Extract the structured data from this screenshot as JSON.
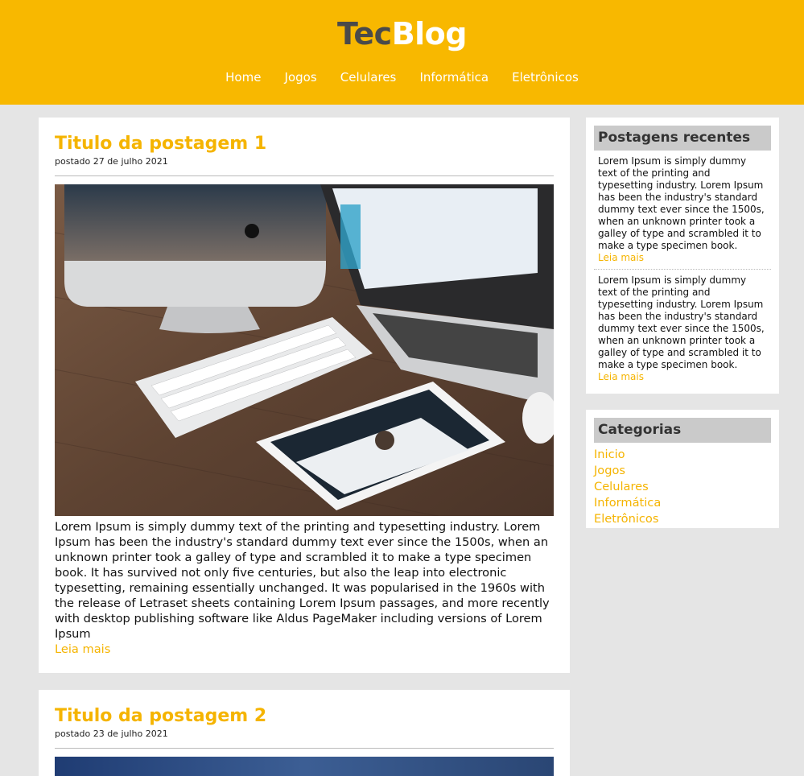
{
  "colors": {
    "brand_yellow": "#f8b800",
    "link_yellow": "#f5b400",
    "logo_dark": "#4a4a4a"
  },
  "header": {
    "logo_part1": "Tec",
    "logo_part2": "Blog",
    "nav": [
      "Home",
      "Jogos",
      "Celulares",
      "Informática",
      "Eletrônicos"
    ]
  },
  "posts": [
    {
      "title": "Titulo da postagem 1",
      "date": "postado 27 de julho 2021",
      "body": "Lorem Ipsum is simply dummy text of the printing and typesetting industry. Lorem Ipsum has been the industry's standard dummy text ever since the 1500s, when an unknown printer took a galley of type and scrambled it to make a type specimen book. It has survived not only five centuries, but also the leap into electronic typesetting, remaining essentially unchanged. It was popularised in the 1960s with the release of Letraset sheets containing Lorem Ipsum passages, and more recently with desktop publishing software like Aldus PageMaker including versions of Lorem Ipsum",
      "more": "Leia mais"
    },
    {
      "title": "Titulo da postagem 2",
      "date": "postado 23 de julho 2021"
    }
  ],
  "sidebar": {
    "recent": {
      "title": "Postagens recentes",
      "items": [
        {
          "text": "Lorem Ipsum is simply dummy text of the printing and typesetting industry. Lorem Ipsum has been the industry's standard dummy text ever since the 1500s, when an unknown printer took a galley of type and scrambled it to make a type specimen book.",
          "more": "Leia mais"
        },
        {
          "text": "Lorem Ipsum is simply dummy text of the printing and typesetting industry. Lorem Ipsum has been the industry's standard dummy text ever since the 1500s, when an unknown printer took a galley of type and scrambled it to make a type specimen book.",
          "more": "Leia mais"
        }
      ]
    },
    "categories": {
      "title": "Categorias",
      "items": [
        "Inicio",
        "Jogos",
        "Celulares",
        "Informática",
        "Eletrônicos"
      ]
    }
  }
}
